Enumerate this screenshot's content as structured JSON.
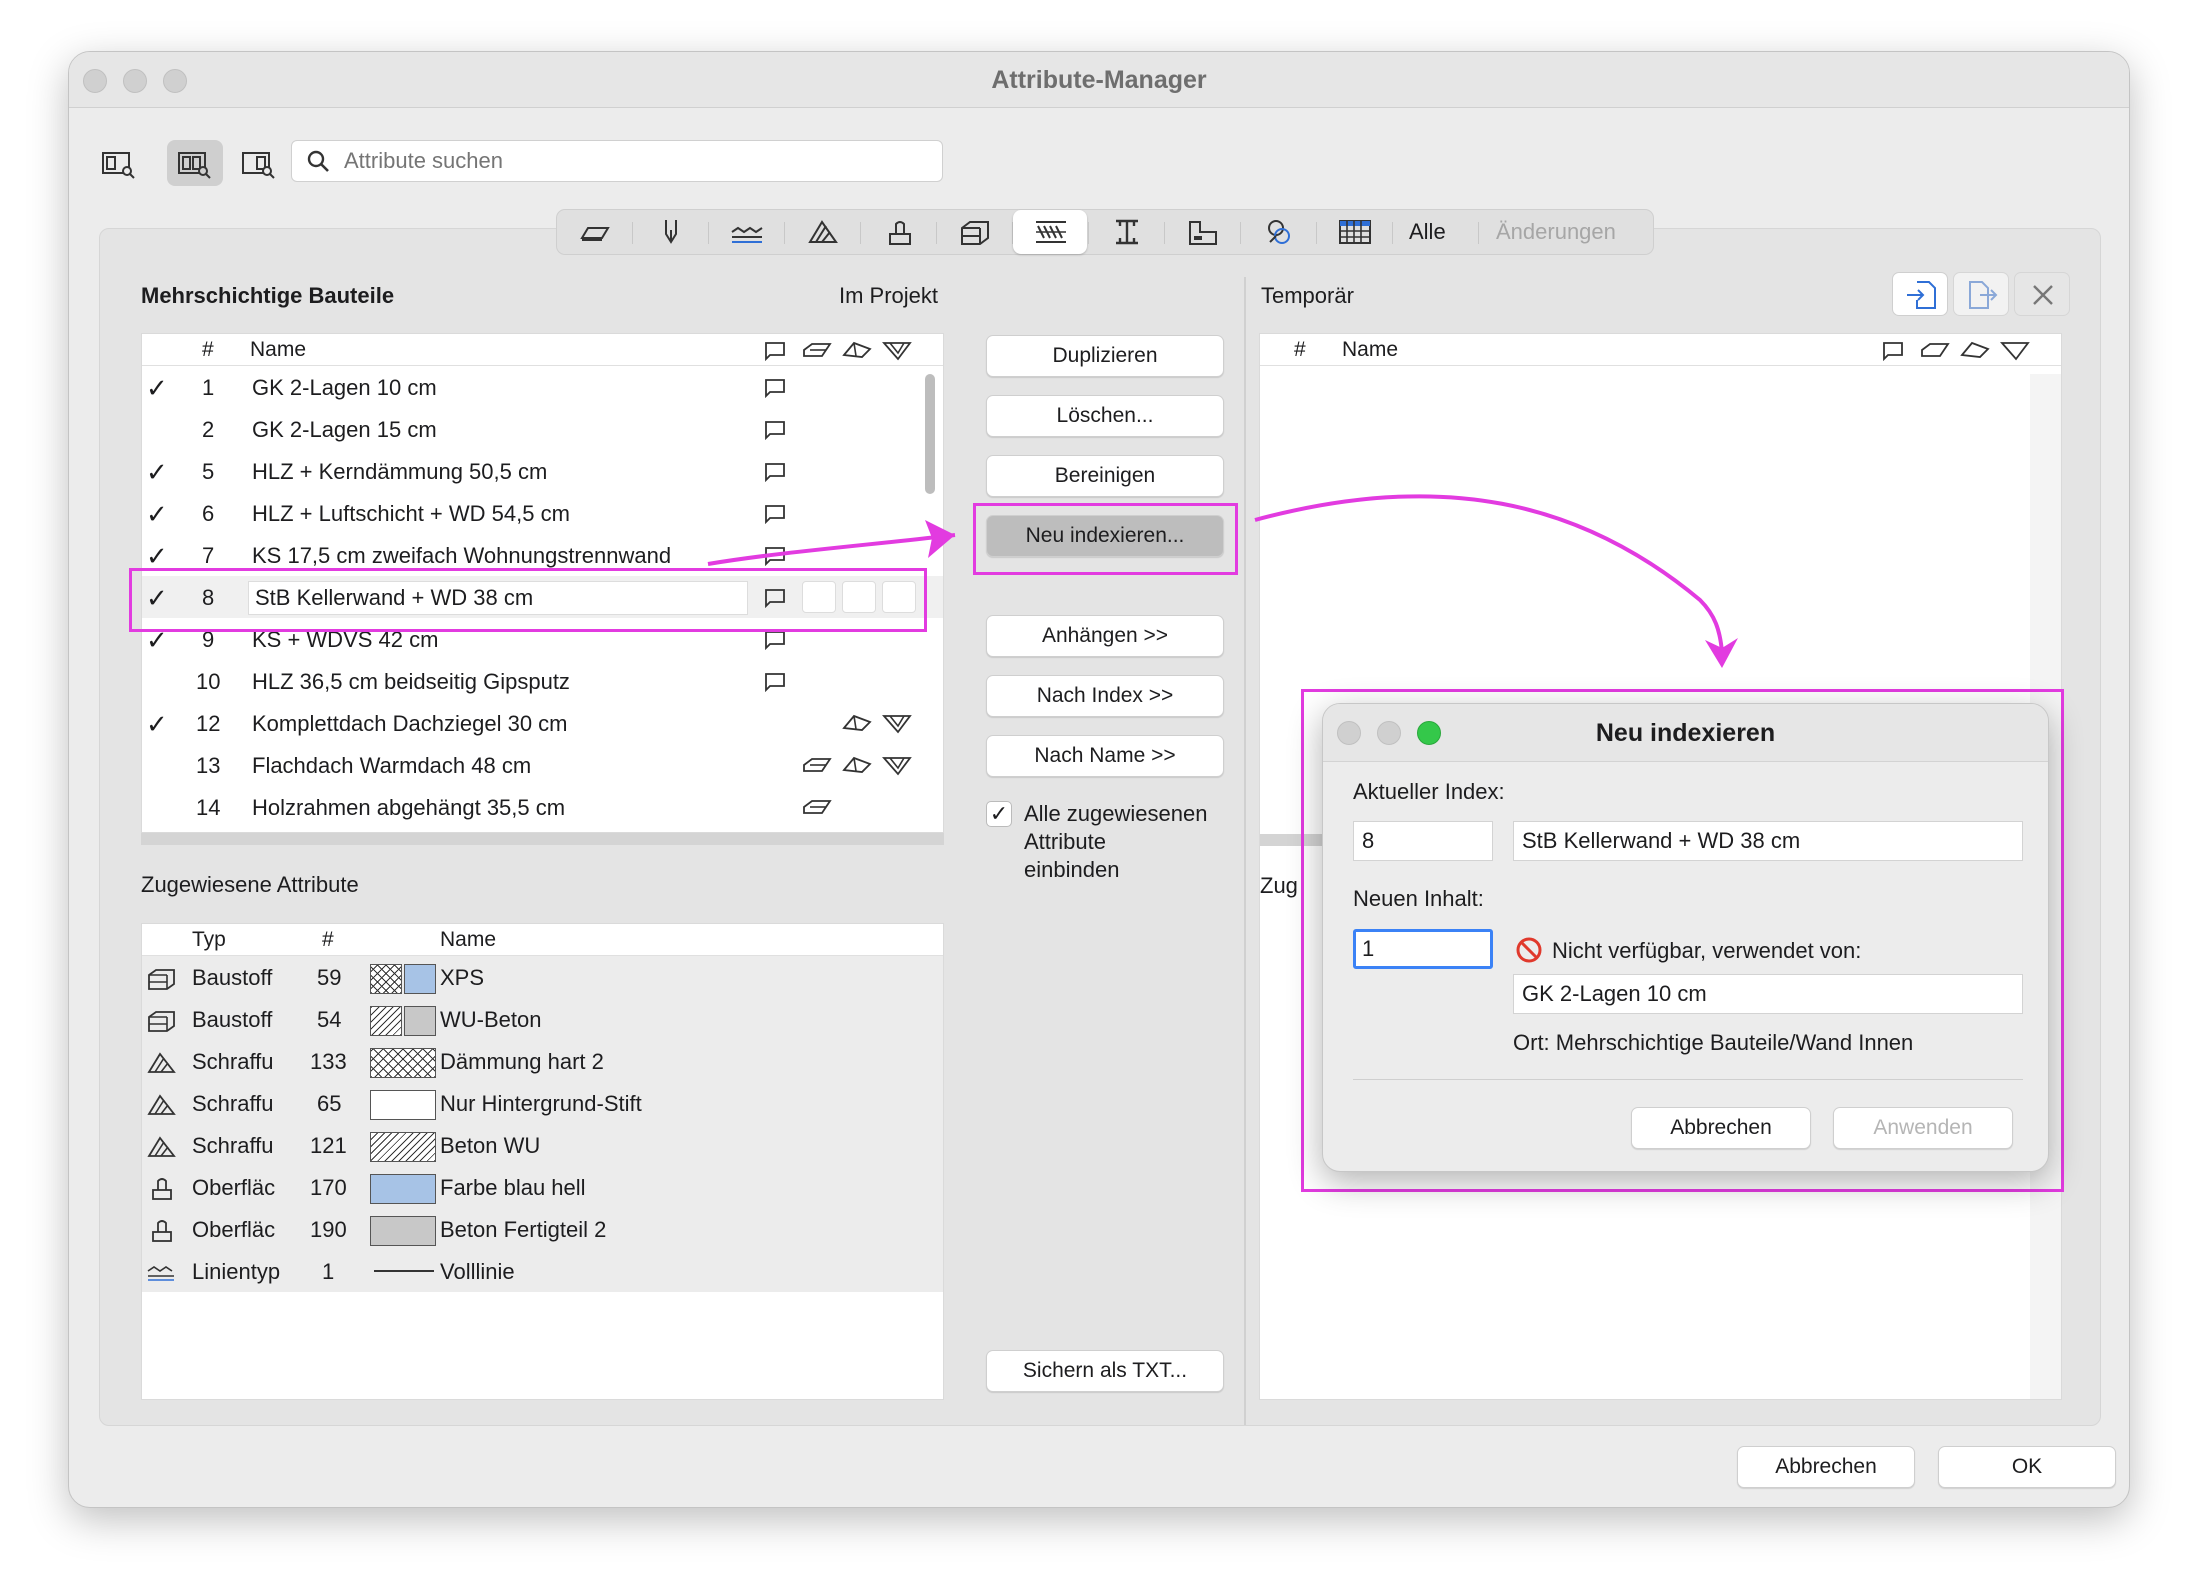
{
  "window": {
    "title": "Attribute-Manager"
  },
  "search": {
    "placeholder": "Attribute suchen"
  },
  "view_buttons": [
    {
      "icon": "view-left-icon"
    },
    {
      "icon": "view-both-icon"
    },
    {
      "icon": "view-right-icon"
    }
  ],
  "attribute_types": [
    {
      "icon": "layer-icon"
    },
    {
      "icon": "pen-icon"
    },
    {
      "icon": "linetype-icon"
    },
    {
      "icon": "fill-icon"
    },
    {
      "icon": "surface-icon"
    },
    {
      "icon": "building-material-icon"
    },
    {
      "icon": "composite-icon"
    },
    {
      "icon": "profile-icon"
    },
    {
      "icon": "zone-icon"
    },
    {
      "icon": "mep-icon"
    },
    {
      "icon": "grid-icon"
    }
  ],
  "segment_labels": {
    "all": "Alle",
    "changes": "Änderungen"
  },
  "left_panel": {
    "title": "Mehrschichtige Bauteile",
    "location": "Im Projekt",
    "columns": {
      "num": "#",
      "name": "Name"
    },
    "rows": [
      {
        "checked": "✓",
        "num": "1",
        "name": "GK 2-Lagen 10 cm",
        "types": [
          "wall"
        ]
      },
      {
        "checked": "",
        "num": "2",
        "name": "GK 2-Lagen 15 cm",
        "types": [
          "wall"
        ]
      },
      {
        "checked": "✓",
        "num": "5",
        "name": "HLZ + Kerndämmung 50,5 cm",
        "types": [
          "wall"
        ]
      },
      {
        "checked": "✓",
        "num": "6",
        "name": "HLZ + Luftschicht + WD 54,5 cm",
        "types": [
          "wall"
        ]
      },
      {
        "checked": "✓",
        "num": "7",
        "name": "KS 17,5 cm zweifach Wohnungstrennwand",
        "types": [
          "wall"
        ]
      },
      {
        "checked": "✓",
        "num": "8",
        "name": "StB Kellerwand + WD 38 cm",
        "types": [
          "wall"
        ]
      },
      {
        "checked": "✓",
        "num": "9",
        "name": "KS + WDVS 42 cm",
        "types": [
          "wall"
        ]
      },
      {
        "checked": "",
        "num": "10",
        "name": "HLZ 36,5 cm beidseitig Gipsputz",
        "types": [
          "wall"
        ]
      },
      {
        "checked": "✓",
        "num": "12",
        "name": "Komplettdach Dachziegel 30 cm",
        "types": [
          "roof",
          "shell"
        ]
      },
      {
        "checked": "",
        "num": "13",
        "name": "Flachdach Warmdach 48 cm",
        "types": [
          "slab",
          "roof",
          "shell"
        ]
      },
      {
        "checked": "",
        "num": "14",
        "name": "Holzrahmen abgehängt 35,5 cm",
        "types": [
          "slab"
        ]
      }
    ]
  },
  "assigned": {
    "title": "Zugewiesene Attribute",
    "columns": {
      "type": "Typ",
      "num": "#",
      "name": "Name"
    },
    "rows": [
      {
        "icon": "building-material-icon",
        "type": "Baustoff",
        "num": "59",
        "name": "XPS",
        "pattern": "cross",
        "color": "#a7c3e6"
      },
      {
        "icon": "building-material-icon",
        "type": "Baustoff",
        "num": "54",
        "name": "WU-Beton",
        "pattern": "diag",
        "color": "#c8c8c8"
      },
      {
        "icon": "fill-icon",
        "type": "Schraffu",
        "num": "133",
        "name": "Dämmung hart 2",
        "pattern": "cross-wide",
        "color": ""
      },
      {
        "icon": "fill-icon",
        "type": "Schraffu",
        "num": "65",
        "name": "Nur Hintergrund-Stift",
        "pattern": "blank-wide",
        "color": ""
      },
      {
        "icon": "fill-icon",
        "type": "Schraffu",
        "num": "121",
        "name": "Beton WU",
        "pattern": "diag-wide",
        "color": ""
      },
      {
        "icon": "surface-icon",
        "type": "Oberfläc",
        "num": "170",
        "name": "Farbe blau hell",
        "pattern": "solid",
        "color": "#a7c3e6"
      },
      {
        "icon": "surface-icon",
        "type": "Oberfläc",
        "num": "190",
        "name": "Beton Fertigteil 2",
        "pattern": "solid",
        "color": "#c8c8c8"
      },
      {
        "icon": "linetype-icon",
        "type": "Linientyp",
        "num": "1",
        "name": "Volllinie",
        "pattern": "line",
        "color": ""
      }
    ]
  },
  "middle_buttons": {
    "duplicate": "Duplizieren",
    "delete": "Löschen...",
    "purge": "Bereinigen",
    "reindex": "Neu indexieren...",
    "append": "Anhängen >>",
    "by_index": "Nach Index >>",
    "by_name": "Nach Name >>",
    "include_label_1": "Alle zugewiesenen",
    "include_label_2": "Attribute",
    "include_label_3": "einbinden",
    "save_txt": "Sichern als TXT..."
  },
  "right_panel": {
    "title": "Temporär",
    "columns": {
      "num": "#",
      "name": "Name"
    },
    "assigned_title_partial": "Zug"
  },
  "footer": {
    "cancel": "Abbrechen",
    "ok": "OK"
  },
  "dialog": {
    "title": "Neu indexieren",
    "current_index_label": "Aktueller Index:",
    "current_index_value": "8",
    "current_name": "StB Kellerwand + WD 38 cm",
    "new_content_label": "Neuen Inhalt:",
    "new_content_value": "1",
    "warning": "Nicht verfügbar, verwendet von:",
    "used_by": "GK 2-Lagen 10 cm",
    "location": "Ort: Mehrschichtige Bauteile/Wand Innen",
    "cancel": "Abbrechen",
    "apply": "Anwenden"
  },
  "colors": {
    "annotation": "#e23be0",
    "accent": "#3b82f6",
    "green": "#34c84a"
  }
}
